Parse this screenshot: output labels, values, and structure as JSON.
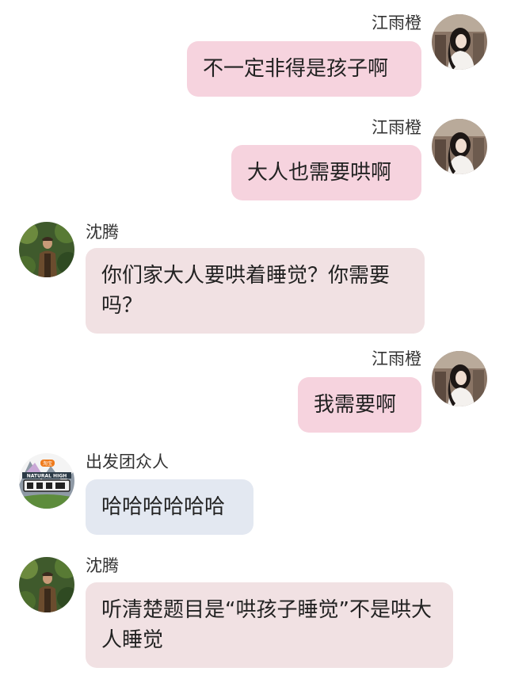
{
  "messages": [
    {
      "sender": "江雨橙",
      "text": "不一定非得是孩子啊",
      "avatar": "woman-portrait-avatar"
    },
    {
      "sender": "江雨橙",
      "text": "大人也需要哄啊",
      "avatar": "woman-portrait-avatar"
    },
    {
      "sender": "沈腾",
      "text": "你们家大人要哄着睡觉？你需要吗？",
      "avatar": "man-jungle-avatar"
    },
    {
      "sender": "江雨橙",
      "text": "我需要啊",
      "avatar": "woman-portrait-avatar"
    },
    {
      "sender": "出发团众人",
      "text": "哈哈哈哈哈哈",
      "avatar": "show-logo-avatar"
    },
    {
      "sender": "沈腾",
      "text": "听清楚题目是“哄孩子睡觉”不是哄大人睡觉",
      "avatar": "man-jungle-avatar"
    }
  ],
  "logo_text": {
    "top": "淘宝",
    "middle": "NATURAL HIGH"
  },
  "colors": {
    "outgoing_bubble": "#f6d3de",
    "incoming_bubble": "#f1e1e3",
    "group_bubble": "#e3e8f1"
  }
}
